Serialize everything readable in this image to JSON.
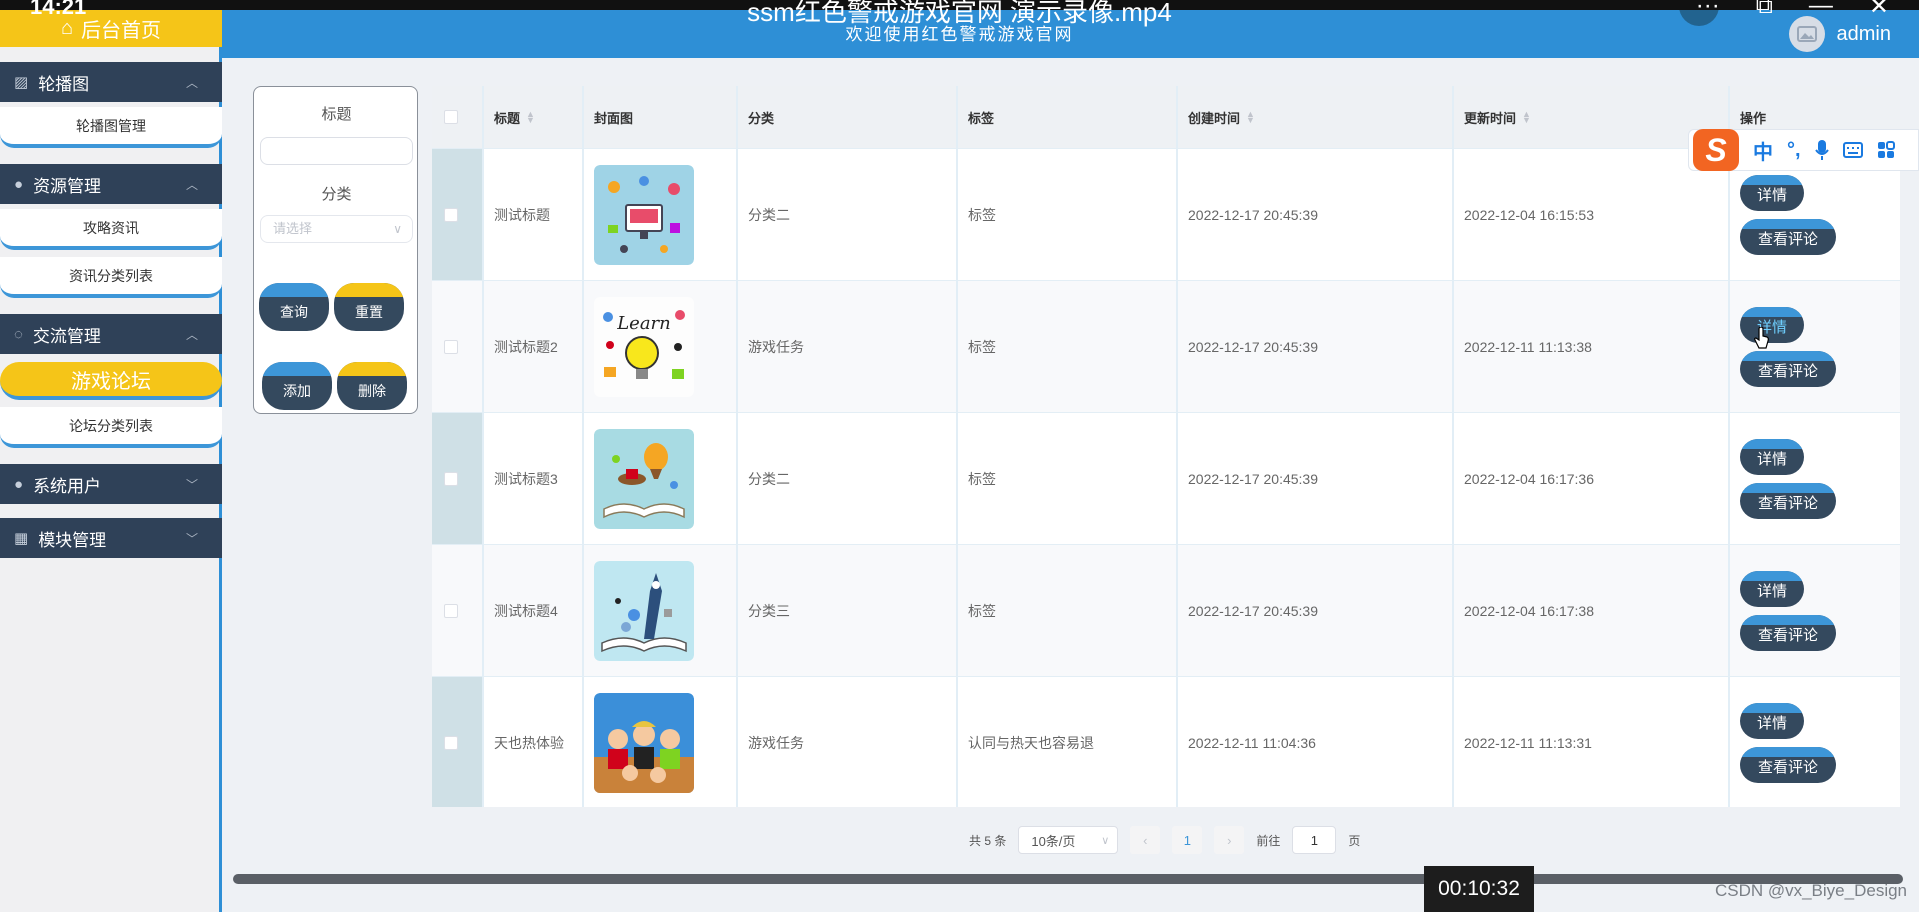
{
  "video": {
    "clock": "14:21",
    "title": "ssm红色警戒游戏官网 演示录像.mp4",
    "timecode": "00:10:32",
    "controls": [
      "···",
      "⧉",
      "—",
      "✕"
    ]
  },
  "header": {
    "subtitle": "欢迎使用红色警戒游戏官网",
    "username": "admin"
  },
  "sidebar": {
    "home": "后台首页",
    "groups": [
      {
        "label": "轮播图",
        "icon": "image-icon",
        "items": [
          "轮播图管理"
        ]
      },
      {
        "label": "资源管理",
        "icon": "bulb-icon",
        "items": [
          "攻略资讯",
          "资讯分类列表"
        ]
      },
      {
        "label": "交流管理",
        "icon": "chat-icon",
        "items": [
          "游戏论坛",
          "论坛分类列表"
        ],
        "active_item": "游戏论坛"
      },
      {
        "label": "系统用户",
        "icon": "user-icon",
        "items": []
      },
      {
        "label": "模块管理",
        "icon": "grid-icon",
        "items": []
      }
    ]
  },
  "search": {
    "title_label": "标题",
    "title_value": "",
    "category_label": "分类",
    "category_placeholder": "请选择",
    "query_button": "查询",
    "reset_button": "重置",
    "add_button": "添加",
    "delete_button": "删除"
  },
  "table": {
    "columns": [
      "标题",
      "封面图",
      "分类",
      "标签",
      "创建时间",
      "更新时间",
      "操作"
    ],
    "rows": [
      {
        "title": "测试标题",
        "category": "分类二",
        "tag": "标签",
        "created": "2022-12-17 20:45:39",
        "updated": "2022-12-04 16:15:53",
        "thumb": "computer-illustration"
      },
      {
        "title": "测试标题2",
        "category": "游戏任务",
        "tag": "标签",
        "created": "2022-12-17 20:45:39",
        "updated": "2022-12-11 11:13:38",
        "thumb": "learn-bulb-illustration"
      },
      {
        "title": "测试标题3",
        "category": "分类二",
        "tag": "标签",
        "created": "2022-12-17 20:45:39",
        "updated": "2022-12-04 16:17:36",
        "thumb": "open-book-balloon"
      },
      {
        "title": "测试标题4",
        "category": "分类三",
        "tag": "标签",
        "created": "2022-12-17 20:45:39",
        "updated": "2022-12-04 16:17:38",
        "thumb": "book-rocket"
      },
      {
        "title": "天也热体验",
        "category": "游戏任务",
        "tag": "认同与热天也容易退",
        "created": "2022-12-11 11:04:36",
        "updated": "2022-12-11 11:13:31",
        "thumb": "anime-group"
      }
    ],
    "detail_button": "详情",
    "comment_button": "查看评论"
  },
  "pager": {
    "total": "共 5 条",
    "page_size": "10条/页",
    "current_page": "1",
    "goto_label": "前往",
    "goto_value": "1",
    "page_suffix": "页"
  },
  "ime": {
    "logo": "S",
    "mode": "中",
    "punct": "°,"
  },
  "watermark": "CSDN @vx_Biye_Design",
  "colors": {
    "header_blue": "#2e8fd6",
    "sidebar_dark": "#2f4158",
    "accent_yellow": "#f5c518",
    "button_dark": "#34495e"
  }
}
